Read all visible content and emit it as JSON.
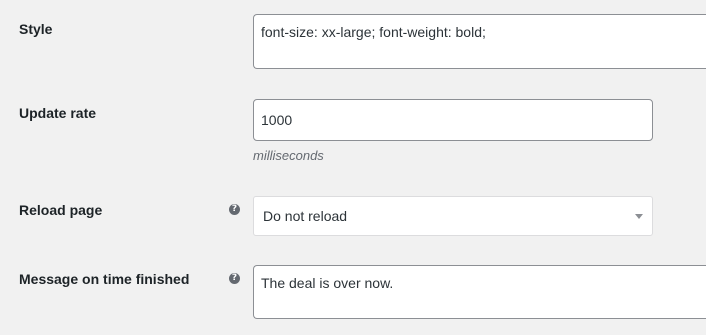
{
  "style": {
    "label": "Style",
    "value": "font-size: xx-large; font-weight: bold;"
  },
  "update_rate": {
    "label": "Update rate",
    "value": "1000",
    "description": "milliseconds"
  },
  "reload_page": {
    "label": "Reload page",
    "help_icon": "question-circle-icon",
    "selected": "Do not reload"
  },
  "message_finished": {
    "label": "Message on time finished",
    "help_icon": "question-circle-icon",
    "value": "The deal is over now."
  }
}
